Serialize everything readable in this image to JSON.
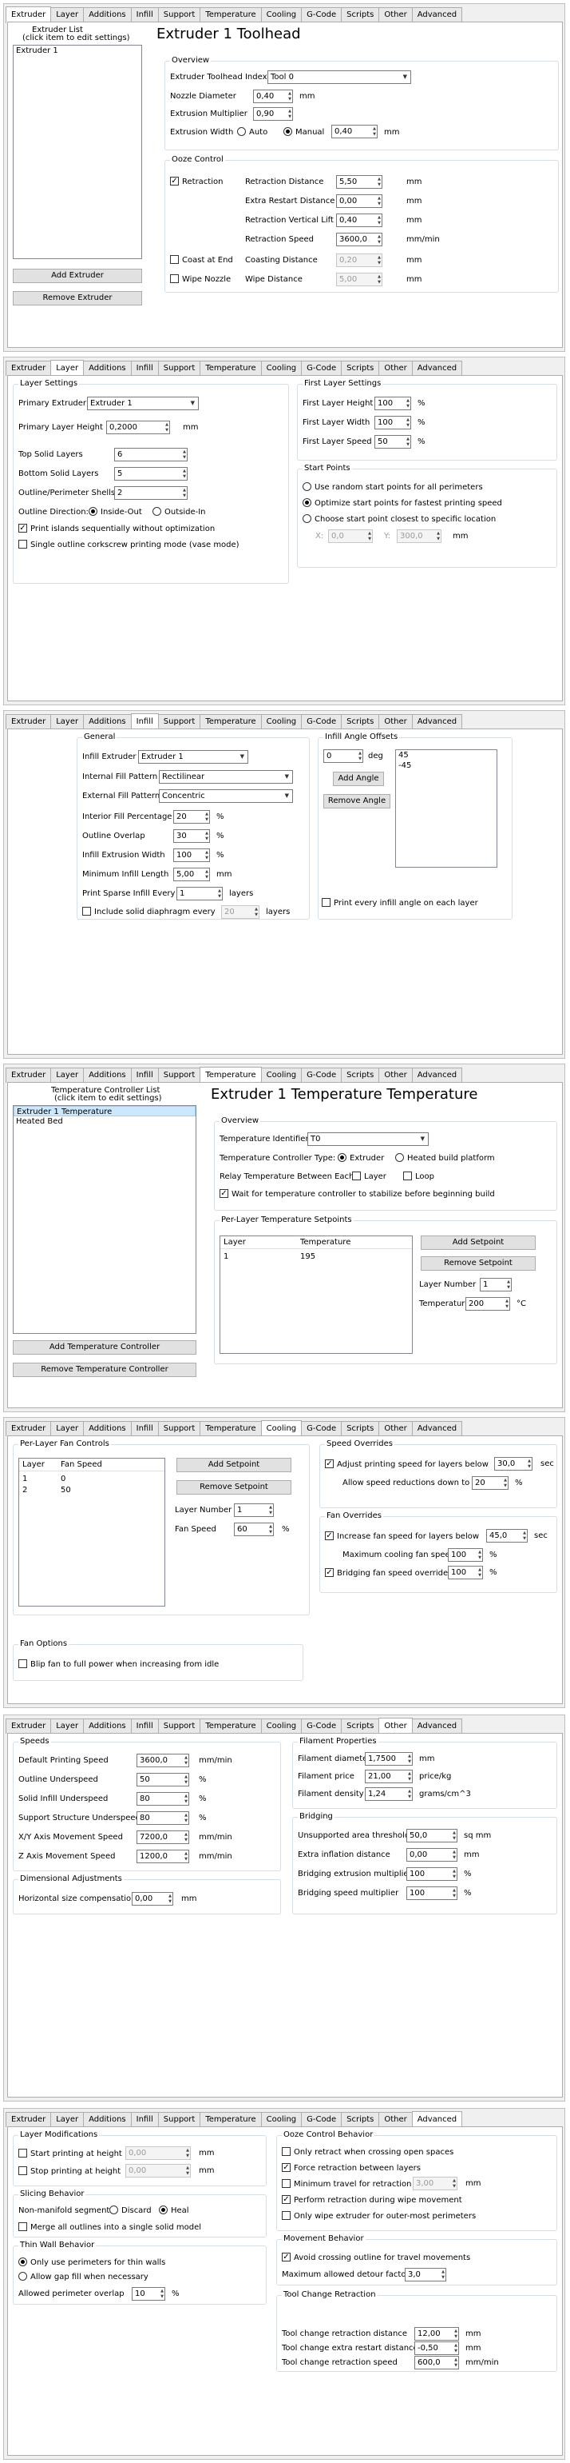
{
  "tab_labels": [
    "Extruder",
    "Layer",
    "Additions",
    "Infill",
    "Support",
    "Temperature",
    "Cooling",
    "G-Code",
    "Scripts",
    "Other",
    "Advanced"
  ],
  "extruder": {
    "list_title": "Extruder List",
    "list_sub": "(click item to edit settings)",
    "list_items": [
      "Extruder 1"
    ],
    "add_btn": "Add Extruder",
    "remove_btn": "Remove Extruder",
    "heading": "Extruder 1 Toolhead",
    "overview_title": "Overview",
    "toolhead_index_lbl": "Extruder Toolhead Index",
    "toolhead_index_val": "Tool 0",
    "nozzle_lbl": "Nozzle Diameter",
    "nozzle_val": "0,40",
    "nozzle_unit": "mm",
    "mult_lbl": "Extrusion Multiplier",
    "mult_val": "0,90",
    "width_lbl": "Extrusion Width",
    "auto_lbl": "Auto",
    "manual_lbl": "Manual",
    "width_val": "0,40",
    "width_unit": "mm",
    "ooze_title": "Ooze Control",
    "retraction_lbl": "Retraction",
    "ret_dist_lbl": "Retraction Distance",
    "ret_dist_val": "5,50",
    "ret_dist_unit": "mm",
    "extra_restart_lbl": "Extra Restart Distance",
    "extra_restart_val": "0,00",
    "extra_restart_unit": "mm",
    "vert_lift_lbl": "Retraction Vertical Lift",
    "vert_lift_val": "0,40",
    "vert_lift_unit": "mm",
    "ret_speed_lbl": "Retraction Speed",
    "ret_speed_val": "3600,0",
    "ret_speed_unit": "mm/min",
    "coast_lbl": "Coast at End",
    "coast_dist_lbl": "Coasting Distance",
    "coast_dist_val": "0,20",
    "coast_dist_unit": "mm",
    "wipe_lbl": "Wipe Nozzle",
    "wipe_dist_lbl": "Wipe Distance",
    "wipe_dist_val": "5,00",
    "wipe_dist_unit": "mm"
  },
  "layer": {
    "settings_title": "Layer Settings",
    "primary_lbl": "Primary Extruder",
    "primary_val": "Extruder 1",
    "height_lbl": "Primary Layer Height",
    "height_val": "0,2000",
    "height_unit": "mm",
    "top_lbl": "Top Solid Layers",
    "top_val": "6",
    "bottom_lbl": "Bottom Solid Layers",
    "bottom_val": "5",
    "shells_lbl": "Outline/Perimeter Shells",
    "shells_val": "2",
    "dir_lbl": "Outline Direction:",
    "inside_lbl": "Inside-Out",
    "outside_lbl": "Outside-In",
    "islands_lbl": "Print islands sequentially without optimization",
    "vase_lbl": "Single outline corkscrew printing mode (vase mode)",
    "first_title": "First Layer Settings",
    "fh_lbl": "First Layer Height",
    "fh_val": "100",
    "fw_lbl": "First Layer Width",
    "fw_val": "100",
    "fs_lbl": "First Layer Speed",
    "fs_val": "50",
    "pct": "%",
    "start_title": "Start Points",
    "sp1": "Use random start points for all perimeters",
    "sp2": "Optimize start points for fastest printing speed",
    "sp3": "Choose start point closest to specific location",
    "x_lbl": "X:",
    "x_val": "0,0",
    "y_lbl": "Y:",
    "y_val": "300,0",
    "xy_unit": "mm"
  },
  "infill": {
    "general_title": "General",
    "ext_lbl": "Infill Extruder",
    "ext_val": "Extruder 1",
    "int_pat_lbl": "Internal Fill Pattern",
    "int_pat_val": "Rectilinear",
    "ext_pat_lbl": "External Fill Pattern",
    "ext_pat_val": "Concentric",
    "pct_lbl": "Interior Fill Percentage",
    "pct_val": "20",
    "overlap_lbl": "Outline Overlap",
    "overlap_val": "30",
    "width_lbl": "Infill Extrusion Width",
    "width_val": "100",
    "min_len_lbl": "Minimum Infill Length",
    "min_len_val": "5,00",
    "mm": "mm",
    "sparse_lbl": "Print Sparse Infill Every",
    "sparse_val": "1",
    "layers": "layers",
    "diaphragm_lbl": "Include solid diaphragm every",
    "diaphragm_val": "20",
    "angle_title": "Infill Angle Offsets",
    "angle_val": "0",
    "deg": "deg",
    "add_angle": "Add Angle",
    "remove_angle": "Remove Angle",
    "angles": [
      "45",
      "-45"
    ],
    "every_angle_lbl": "Print every infill angle on each layer",
    "pct": "%"
  },
  "temperature": {
    "list_title": "Temperature Controller List",
    "list_sub": "(click item to edit settings)",
    "list_items": [
      "Extruder 1 Temperature",
      "Heated Bed"
    ],
    "add_btn": "Add Temperature Controller",
    "remove_btn": "Remove Temperature Controller",
    "heading": "Extruder 1 Temperature Temperature",
    "overview_title": "Overview",
    "ident_lbl": "Temperature Identifier",
    "ident_val": "T0",
    "type_lbl": "Temperature Controller Type:",
    "type_ext": "Extruder",
    "type_bed": "Heated build platform",
    "relay_lbl": "Relay Temperature Between Each:",
    "relay_layer": "Layer",
    "relay_loop": "Loop",
    "wait_lbl": "Wait for temperature controller to stabilize before beginning build",
    "setpoints_title": "Per-Layer Temperature Setpoints",
    "col_layer": "Layer",
    "col_temp": "Temperature",
    "rows": [
      [
        "1",
        "195"
      ]
    ],
    "add_sp": "Add Setpoint",
    "remove_sp": "Remove Setpoint",
    "ln_lbl": "Layer Number",
    "ln_val": "1",
    "t_lbl": "Temperature",
    "t_val": "200",
    "t_unit": "°C"
  },
  "cooling": {
    "fan_title": "Per-Layer Fan Controls",
    "col_layer": "Layer",
    "col_fan": "Fan Speed",
    "rows": [
      [
        "1",
        "0"
      ],
      [
        "2",
        "50"
      ]
    ],
    "add_sp": "Add Setpoint",
    "remove_sp": "Remove Setpoint",
    "ln_lbl": "Layer Number",
    "ln_val": "1",
    "fs_lbl": "Fan Speed",
    "fs_val": "60",
    "pct": "%",
    "speed_title": "Speed Overrides",
    "adj_lbl": "Adjust printing speed for layers below",
    "adj_val": "30,0",
    "sec": "sec",
    "allow_lbl": "Allow speed reductions down to",
    "allow_val": "20",
    "fan_ov_title": "Fan Overrides",
    "inc_lbl": "Increase fan speed for layers below",
    "inc_val": "45,0",
    "max_lbl": "Maximum cooling fan speed",
    "max_val": "100",
    "bridge_lbl": "Bridging fan speed override",
    "bridge_val": "100",
    "options_title": "Fan Options",
    "blip_lbl": "Blip fan to full power when increasing from idle"
  },
  "other": {
    "speeds_title": "Speeds",
    "speeds": [
      {
        "label": "Default Printing Speed",
        "value": "3600,0",
        "unit": "mm/min"
      },
      {
        "label": "Outline Underspeed",
        "value": "50",
        "unit": "%"
      },
      {
        "label": "Solid Infill Underspeed",
        "value": "80",
        "unit": "%"
      },
      {
        "label": "Support Structure Underspeed",
        "value": "80",
        "unit": "%"
      },
      {
        "label": "X/Y Axis Movement Speed",
        "value": "7200,0",
        "unit": "mm/min"
      },
      {
        "label": "Z Axis Movement Speed",
        "value": "1200,0",
        "unit": "mm/min"
      }
    ],
    "dim_title": "Dimensional Adjustments",
    "hsc_lbl": "Horizontal size compensation",
    "hsc_val": "0,00",
    "hsc_unit": "mm",
    "fil_title": "Filament Properties",
    "filament": [
      {
        "label": "Filament diameter",
        "value": "1,7500",
        "unit": "mm"
      },
      {
        "label": "Filament price",
        "value": "21,00",
        "unit": "price/kg"
      },
      {
        "label": "Filament density",
        "value": "1,24",
        "unit": "grams/cm^3"
      }
    ],
    "bridge_title": "Bridging",
    "bridging": [
      {
        "label": "Unsupported area threshold",
        "value": "50,0",
        "unit": "sq mm"
      },
      {
        "label": "Extra inflation distance",
        "value": "0,00",
        "unit": "mm"
      },
      {
        "label": "Bridging extrusion multiplier",
        "value": "100",
        "unit": "%"
      },
      {
        "label": "Bridging speed multiplier",
        "value": "100",
        "unit": "%"
      }
    ]
  },
  "advanced": {
    "layer_mod_title": "Layer Modifications",
    "start_h_lbl": "Start printing at height",
    "start_h_val": "0,00",
    "stop_h_lbl": "Stop printing at height",
    "stop_h_val": "0,00",
    "mm": "mm",
    "slicing_title": "Slicing Behavior",
    "nonmanifold_lbl": "Non-manifold segments:",
    "discard_lbl": "Discard",
    "heal_lbl": "Heal",
    "merge_lbl": "Merge all outlines into a single solid model",
    "thin_title": "Thin Wall Behavior",
    "thin1": "Only use perimeters for thin walls",
    "thin2": "Allow gap fill when necessary",
    "overlap_lbl": "Allowed perimeter overlap",
    "overlap_val": "10",
    "pct": "%",
    "ooze_title": "Ooze Control Behavior",
    "oc1": "Only retract when crossing open spaces",
    "oc2": "Force retraction between layers",
    "oc3": "Minimum travel for retraction",
    "oc3_val": "3,00",
    "oc4": "Perform retraction during wipe movement",
    "oc5": "Only wipe extruder for outer-most perimeters",
    "move_title": "Movement Behavior",
    "avoid_lbl": "Avoid crossing outline for travel movements",
    "detour_lbl": "Maximum allowed detour factor",
    "detour_val": "3,0",
    "tc_title": "Tool Change Retraction",
    "tc_dist_lbl": "Tool change retraction distance",
    "tc_dist_val": "12,00",
    "tc_extra_lbl": "Tool change extra restart distance",
    "tc_extra_val": "-0,50",
    "tc_speed_lbl": "Tool change retraction speed",
    "tc_speed_val": "600,0",
    "mmmin": "mm/min"
  }
}
